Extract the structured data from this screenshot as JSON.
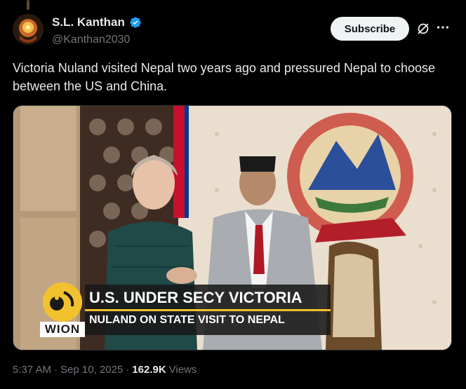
{
  "author": {
    "display_name": "S.L. Kanthan",
    "handle": "@Kanthan2030",
    "verified": true
  },
  "actions": {
    "subscribe_label": "Subscribe"
  },
  "post": {
    "text": "Victoria Nuland visited Nepal two years ago and pressured Nepal to choose between the US and China."
  },
  "media": {
    "banner_line1": "U.S. UNDER SECY VICTORIA",
    "banner_line2": "NULAND ON STATE VISIT TO NEPAL",
    "channel_logo": "WION"
  },
  "meta": {
    "time": "5:37 AM",
    "separator": "·",
    "date": "Sep 10, 2025",
    "views_count": "162.9K",
    "views_label": "Views"
  },
  "colors": {
    "background": "#000000",
    "text_primary": "#e7e9ea",
    "text_secondary": "#71767b",
    "verified_blue": "#1d9bf0",
    "button_bg": "#eff3f4",
    "wion_yellow": "#f2c12e"
  }
}
